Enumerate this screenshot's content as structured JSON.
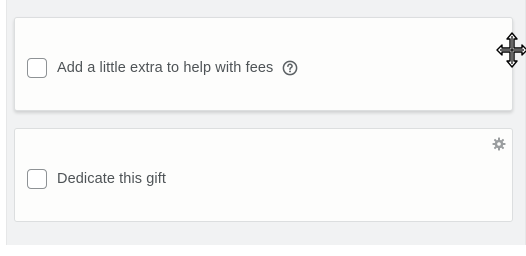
{
  "fees_option": {
    "label": "Add a little extra to help with fees",
    "checked": false,
    "help_icon": "question-circle-icon"
  },
  "dedicate_option": {
    "label": "Dedicate this gift",
    "checked": false,
    "settings_icon": "gear-icon"
  },
  "cursor": "move-cursor-icon",
  "colors": {
    "panel_bg": "#f1f2f3",
    "card_bg": "#fdfdfc",
    "card_border": "#dcdedf",
    "text": "#4e5356",
    "icon": "#9a9d9f"
  }
}
